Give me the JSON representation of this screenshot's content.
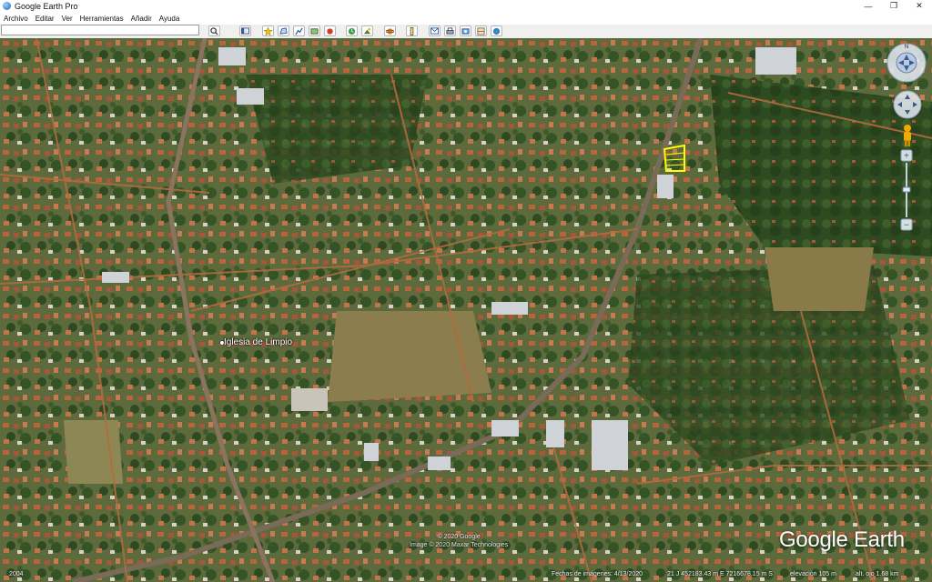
{
  "window": {
    "title": "Google Earth Pro"
  },
  "menu": {
    "items": [
      "Archivo",
      "Editar",
      "Ver",
      "Herramientas",
      "Añadir",
      "Ayuda"
    ]
  },
  "search": {
    "value": "",
    "placeholder": ""
  },
  "map": {
    "place_label": "Iglesia de Limpio",
    "copyright_line1": "© 2020 Google",
    "copyright_line2": "Image © 2020 Maxar Technologies",
    "logo": "Google Earth"
  },
  "status": {
    "year": "2004",
    "imagery_date": "Fechas de imágenes: 4/13/2020",
    "coords": "21 J 452183.43 m E 7216678.15 m S",
    "elevation": "elevación  105 m",
    "eye_alt": "alt. ojo  1.68 km"
  },
  "compass": {
    "north_label": "N"
  }
}
